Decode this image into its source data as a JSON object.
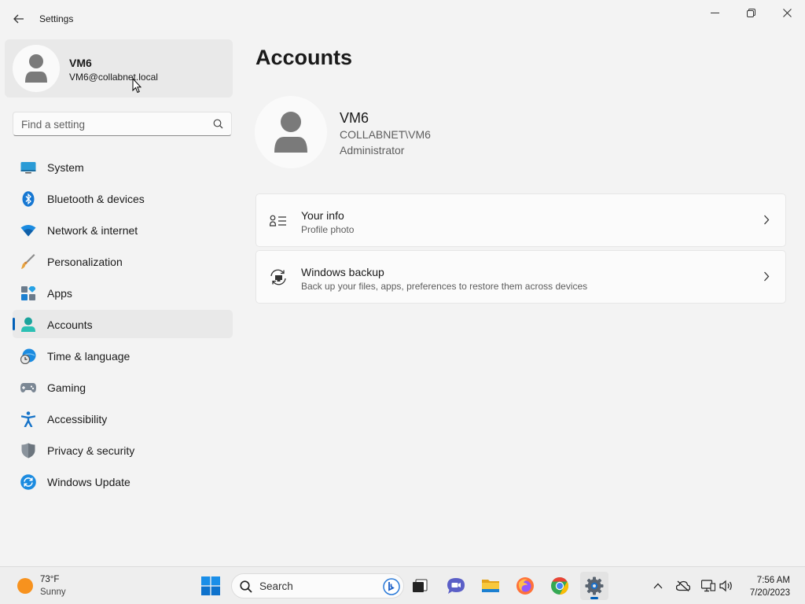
{
  "window": {
    "title": "Settings"
  },
  "sidebar": {
    "user": {
      "name": "VM6",
      "email": "VM6@collabnet.local"
    },
    "search_placeholder": "Find a setting",
    "items": [
      {
        "label": "System",
        "icon": "system-icon"
      },
      {
        "label": "Bluetooth & devices",
        "icon": "bluetooth-icon"
      },
      {
        "label": "Network & internet",
        "icon": "wifi-icon"
      },
      {
        "label": "Personalization",
        "icon": "paintbrush-icon"
      },
      {
        "label": "Apps",
        "icon": "apps-icon"
      },
      {
        "label": "Accounts",
        "icon": "accounts-icon",
        "selected": true
      },
      {
        "label": "Time & language",
        "icon": "globe-clock-icon"
      },
      {
        "label": "Gaming",
        "icon": "gamepad-icon"
      },
      {
        "label": "Accessibility",
        "icon": "accessibility-icon"
      },
      {
        "label": "Privacy & security",
        "icon": "shield-icon"
      },
      {
        "label": "Windows Update",
        "icon": "update-icon"
      }
    ]
  },
  "main": {
    "title": "Accounts",
    "profile": {
      "name": "VM6",
      "domain": "COLLABNET\\VM6",
      "role": "Administrator"
    },
    "cards": [
      {
        "title": "Your info",
        "subtitle": "Profile photo",
        "icon": "person-details-icon"
      },
      {
        "title": "Windows backup",
        "subtitle": "Back up your files, apps, preferences to restore them across devices",
        "icon": "backup-sync-icon"
      }
    ]
  },
  "taskbar": {
    "weather": {
      "temp": "73°F",
      "condition": "Sunny"
    },
    "search_label": "Search",
    "time": "7:56 AM",
    "date": "7/20/2023"
  },
  "colors": {
    "accent": "#005fb8",
    "background": "#f3f3f3",
    "card": "#fbfbfb"
  }
}
